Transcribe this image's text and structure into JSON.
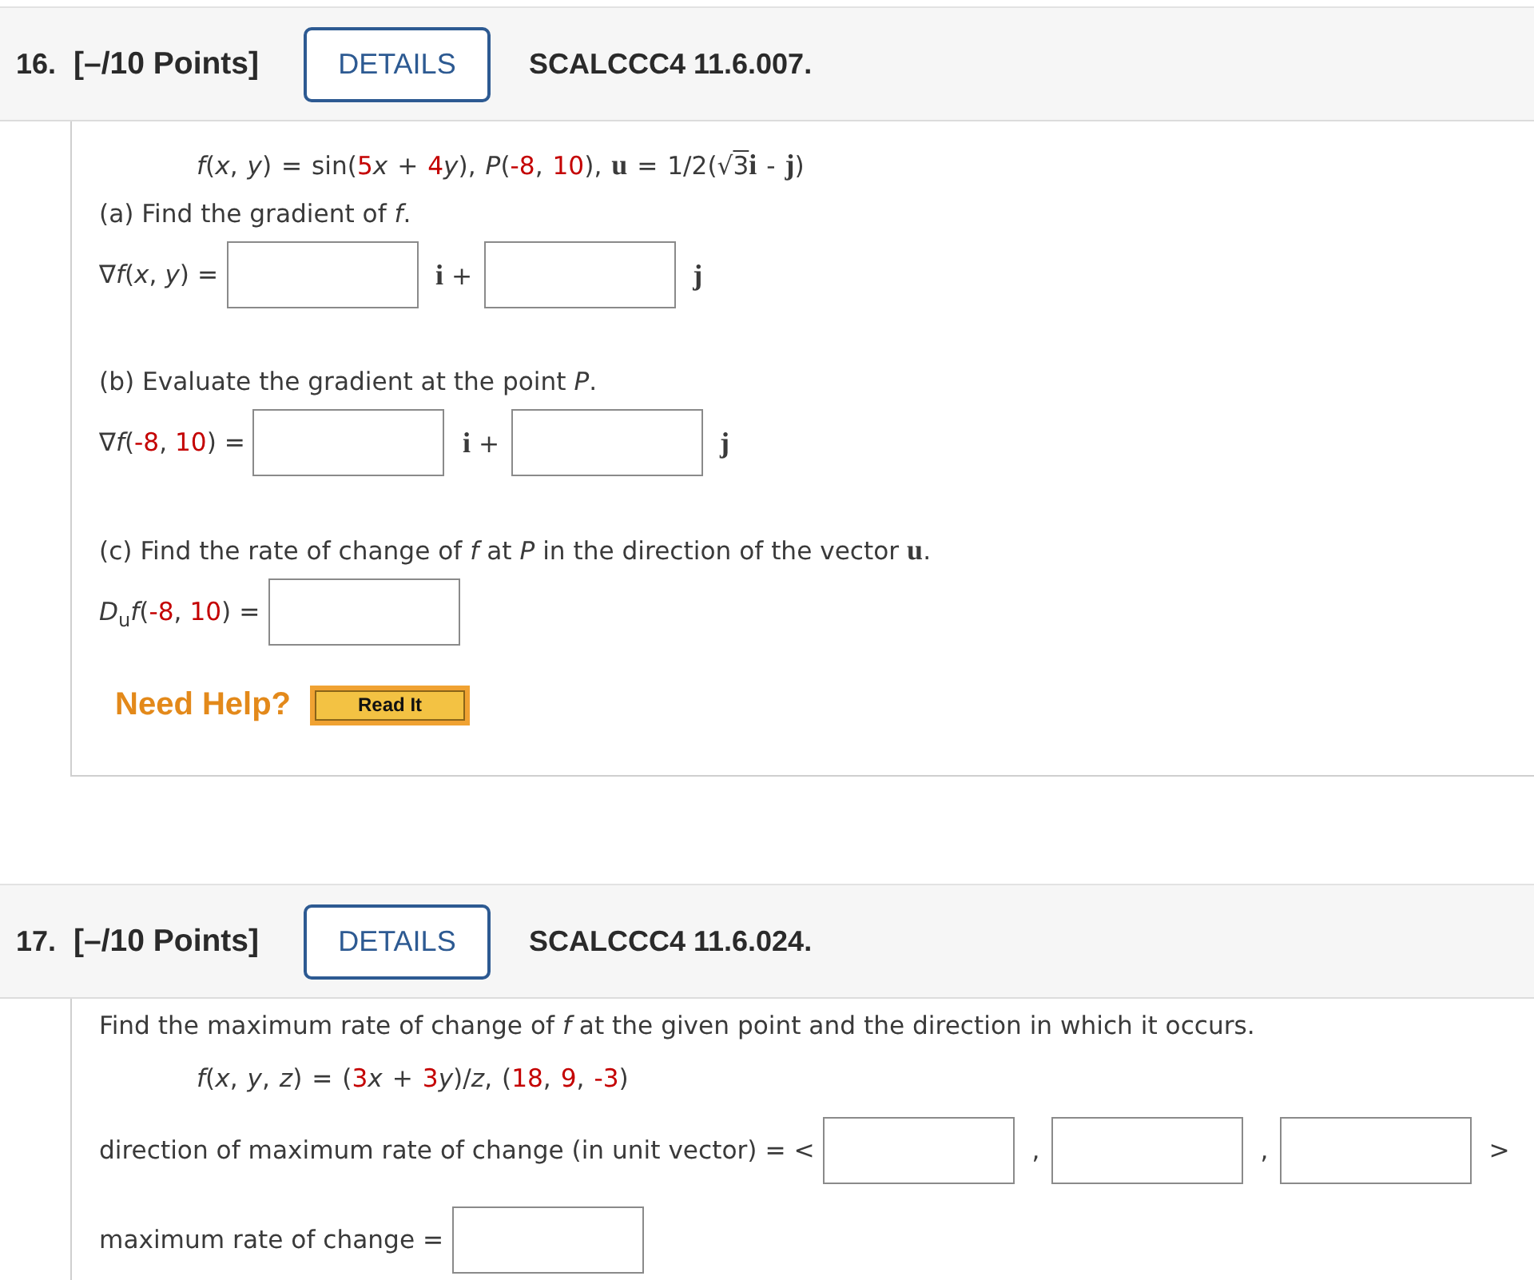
{
  "questions": [
    {
      "number": "16.",
      "points": "[–/10 Points]",
      "details_button": "DETAILS",
      "code": "SCALCCC4 11.6.007.",
      "lines": [
        {
          "kind": "formula",
          "parts": [
            {
              "kind": "text",
              "text": "*f*(*x*, *y*) = sin("
            },
            {
              "kind": "given",
              "text": "5"
            },
            {
              "kind": "text",
              "text": "*x* + "
            },
            {
              "kind": "given",
              "text": "4"
            },
            {
              "kind": "text",
              "text": "*y*), *P*("
            },
            {
              "kind": "given",
              "text": "-8"
            },
            {
              "kind": "text",
              "text": ", "
            },
            {
              "kind": "given",
              "text": "10"
            },
            {
              "kind": "text",
              "text": "), **u** = 1/2(√"
            },
            {
              "kind": "radicand",
              "text": "3"
            },
            {
              "kind": "text",
              "text": "**i** - **j**)"
            }
          ]
        },
        {
          "kind": "prompt",
          "text": "(a) Find the gradient of *f*."
        },
        {
          "kind": "row",
          "items": [
            {
              "kind": "math",
              "parts": [
                {
                  "kind": "text",
                  "text": "∇*f*(*x*, *y*) ="
                }
              ]
            },
            {
              "kind": "answer"
            },
            {
              "kind": "unit",
              "text": "**i** +"
            },
            {
              "kind": "answer"
            },
            {
              "kind": "unit",
              "text": "**j**"
            }
          ]
        },
        {
          "kind": "prompt",
          "text": "(b) Evaluate the gradient at the point *P*."
        },
        {
          "kind": "row",
          "items": [
            {
              "kind": "math",
              "parts": [
                {
                  "kind": "text",
                  "text": "∇*f*("
                },
                {
                  "kind": "given",
                  "text": "-8"
                },
                {
                  "kind": "text",
                  "text": ", "
                },
                {
                  "kind": "given",
                  "text": "10"
                },
                {
                  "kind": "text",
                  "text": ") ="
                }
              ]
            },
            {
              "kind": "answer"
            },
            {
              "kind": "unit",
              "text": "**i** +"
            },
            {
              "kind": "answer"
            },
            {
              "kind": "unit",
              "text": "**j**"
            }
          ]
        },
        {
          "kind": "prompt",
          "text": "(c) Find the rate of change of *f* at *P* in the direction of the vector **u**."
        },
        {
          "kind": "row",
          "items": [
            {
              "kind": "math",
              "parts": [
                {
                  "kind": "text",
                  "text": "*D*$_{u}$*f*("
                },
                {
                  "kind": "given",
                  "text": "-8"
                },
                {
                  "kind": "text",
                  "text": ", "
                },
                {
                  "kind": "given",
                  "text": "10"
                },
                {
                  "kind": "text",
                  "text": ") ="
                }
              ]
            },
            {
              "kind": "answer"
            }
          ]
        }
      ],
      "help": {
        "label": "Need Help?",
        "button": "Read It"
      }
    },
    {
      "number": "17.",
      "points": "[–/10 Points]",
      "details_button": "DETAILS",
      "code": "SCALCCC4 11.6.024.",
      "lines": [
        {
          "kind": "prompt",
          "text": "Find the maximum rate of change of *f* at the given point and the direction in which it occurs."
        },
        {
          "kind": "formula",
          "parts": [
            {
              "kind": "text",
              "text": "*f*(*x*, *y*, *z*) = ("
            },
            {
              "kind": "given",
              "text": "3"
            },
            {
              "kind": "text",
              "text": "*x* + "
            },
            {
              "kind": "given",
              "text": "3"
            },
            {
              "kind": "text",
              "text": "*y*)/*z*, ("
            },
            {
              "kind": "given",
              "text": "18"
            },
            {
              "kind": "text",
              "text": ", "
            },
            {
              "kind": "given",
              "text": "9"
            },
            {
              "kind": "text",
              "text": ", "
            },
            {
              "kind": "given",
              "text": "-3"
            },
            {
              "kind": "text",
              "text": ")"
            }
          ]
        },
        {
          "kind": "row",
          "items": [
            {
              "kind": "math",
              "parts": [
                {
                  "kind": "text",
                  "text": "direction of maximum rate of change (in unit vector) = <"
                }
              ]
            },
            {
              "kind": "answer"
            },
            {
              "kind": "unit",
              "text": ","
            },
            {
              "kind": "answer"
            },
            {
              "kind": "unit",
              "text": ","
            },
            {
              "kind": "answer"
            },
            {
              "kind": "unit",
              "text": ">"
            }
          ]
        },
        {
          "kind": "row",
          "items": [
            {
              "kind": "math",
              "parts": [
                {
                  "kind": "text",
                  "text": "maximum rate of change ="
                }
              ]
            },
            {
              "kind": "answer"
            }
          ]
        }
      ]
    }
  ]
}
